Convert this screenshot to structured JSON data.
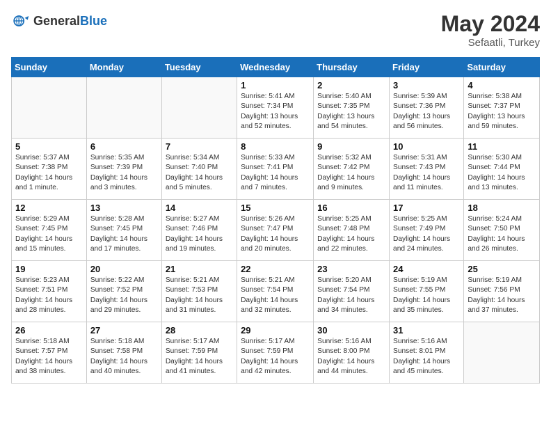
{
  "header": {
    "logo_general": "General",
    "logo_blue": "Blue",
    "month": "May 2024",
    "location": "Sefaatli, Turkey"
  },
  "days_of_week": [
    "Sunday",
    "Monday",
    "Tuesday",
    "Wednesday",
    "Thursday",
    "Friday",
    "Saturday"
  ],
  "weeks": [
    [
      {
        "day": "",
        "info": ""
      },
      {
        "day": "",
        "info": ""
      },
      {
        "day": "",
        "info": ""
      },
      {
        "day": "1",
        "info": "Sunrise: 5:41 AM\nSunset: 7:34 PM\nDaylight: 13 hours\nand 52 minutes."
      },
      {
        "day": "2",
        "info": "Sunrise: 5:40 AM\nSunset: 7:35 PM\nDaylight: 13 hours\nand 54 minutes."
      },
      {
        "day": "3",
        "info": "Sunrise: 5:39 AM\nSunset: 7:36 PM\nDaylight: 13 hours\nand 56 minutes."
      },
      {
        "day": "4",
        "info": "Sunrise: 5:38 AM\nSunset: 7:37 PM\nDaylight: 13 hours\nand 59 minutes."
      }
    ],
    [
      {
        "day": "5",
        "info": "Sunrise: 5:37 AM\nSunset: 7:38 PM\nDaylight: 14 hours\nand 1 minute."
      },
      {
        "day": "6",
        "info": "Sunrise: 5:35 AM\nSunset: 7:39 PM\nDaylight: 14 hours\nand 3 minutes."
      },
      {
        "day": "7",
        "info": "Sunrise: 5:34 AM\nSunset: 7:40 PM\nDaylight: 14 hours\nand 5 minutes."
      },
      {
        "day": "8",
        "info": "Sunrise: 5:33 AM\nSunset: 7:41 PM\nDaylight: 14 hours\nand 7 minutes."
      },
      {
        "day": "9",
        "info": "Sunrise: 5:32 AM\nSunset: 7:42 PM\nDaylight: 14 hours\nand 9 minutes."
      },
      {
        "day": "10",
        "info": "Sunrise: 5:31 AM\nSunset: 7:43 PM\nDaylight: 14 hours\nand 11 minutes."
      },
      {
        "day": "11",
        "info": "Sunrise: 5:30 AM\nSunset: 7:44 PM\nDaylight: 14 hours\nand 13 minutes."
      }
    ],
    [
      {
        "day": "12",
        "info": "Sunrise: 5:29 AM\nSunset: 7:45 PM\nDaylight: 14 hours\nand 15 minutes."
      },
      {
        "day": "13",
        "info": "Sunrise: 5:28 AM\nSunset: 7:45 PM\nDaylight: 14 hours\nand 17 minutes."
      },
      {
        "day": "14",
        "info": "Sunrise: 5:27 AM\nSunset: 7:46 PM\nDaylight: 14 hours\nand 19 minutes."
      },
      {
        "day": "15",
        "info": "Sunrise: 5:26 AM\nSunset: 7:47 PM\nDaylight: 14 hours\nand 20 minutes."
      },
      {
        "day": "16",
        "info": "Sunrise: 5:25 AM\nSunset: 7:48 PM\nDaylight: 14 hours\nand 22 minutes."
      },
      {
        "day": "17",
        "info": "Sunrise: 5:25 AM\nSunset: 7:49 PM\nDaylight: 14 hours\nand 24 minutes."
      },
      {
        "day": "18",
        "info": "Sunrise: 5:24 AM\nSunset: 7:50 PM\nDaylight: 14 hours\nand 26 minutes."
      }
    ],
    [
      {
        "day": "19",
        "info": "Sunrise: 5:23 AM\nSunset: 7:51 PM\nDaylight: 14 hours\nand 28 minutes."
      },
      {
        "day": "20",
        "info": "Sunrise: 5:22 AM\nSunset: 7:52 PM\nDaylight: 14 hours\nand 29 minutes."
      },
      {
        "day": "21",
        "info": "Sunrise: 5:21 AM\nSunset: 7:53 PM\nDaylight: 14 hours\nand 31 minutes."
      },
      {
        "day": "22",
        "info": "Sunrise: 5:21 AM\nSunset: 7:54 PM\nDaylight: 14 hours\nand 32 minutes."
      },
      {
        "day": "23",
        "info": "Sunrise: 5:20 AM\nSunset: 7:54 PM\nDaylight: 14 hours\nand 34 minutes."
      },
      {
        "day": "24",
        "info": "Sunrise: 5:19 AM\nSunset: 7:55 PM\nDaylight: 14 hours\nand 35 minutes."
      },
      {
        "day": "25",
        "info": "Sunrise: 5:19 AM\nSunset: 7:56 PM\nDaylight: 14 hours\nand 37 minutes."
      }
    ],
    [
      {
        "day": "26",
        "info": "Sunrise: 5:18 AM\nSunset: 7:57 PM\nDaylight: 14 hours\nand 38 minutes."
      },
      {
        "day": "27",
        "info": "Sunrise: 5:18 AM\nSunset: 7:58 PM\nDaylight: 14 hours\nand 40 minutes."
      },
      {
        "day": "28",
        "info": "Sunrise: 5:17 AM\nSunset: 7:59 PM\nDaylight: 14 hours\nand 41 minutes."
      },
      {
        "day": "29",
        "info": "Sunrise: 5:17 AM\nSunset: 7:59 PM\nDaylight: 14 hours\nand 42 minutes."
      },
      {
        "day": "30",
        "info": "Sunrise: 5:16 AM\nSunset: 8:00 PM\nDaylight: 14 hours\nand 44 minutes."
      },
      {
        "day": "31",
        "info": "Sunrise: 5:16 AM\nSunset: 8:01 PM\nDaylight: 14 hours\nand 45 minutes."
      },
      {
        "day": "",
        "info": ""
      }
    ]
  ]
}
